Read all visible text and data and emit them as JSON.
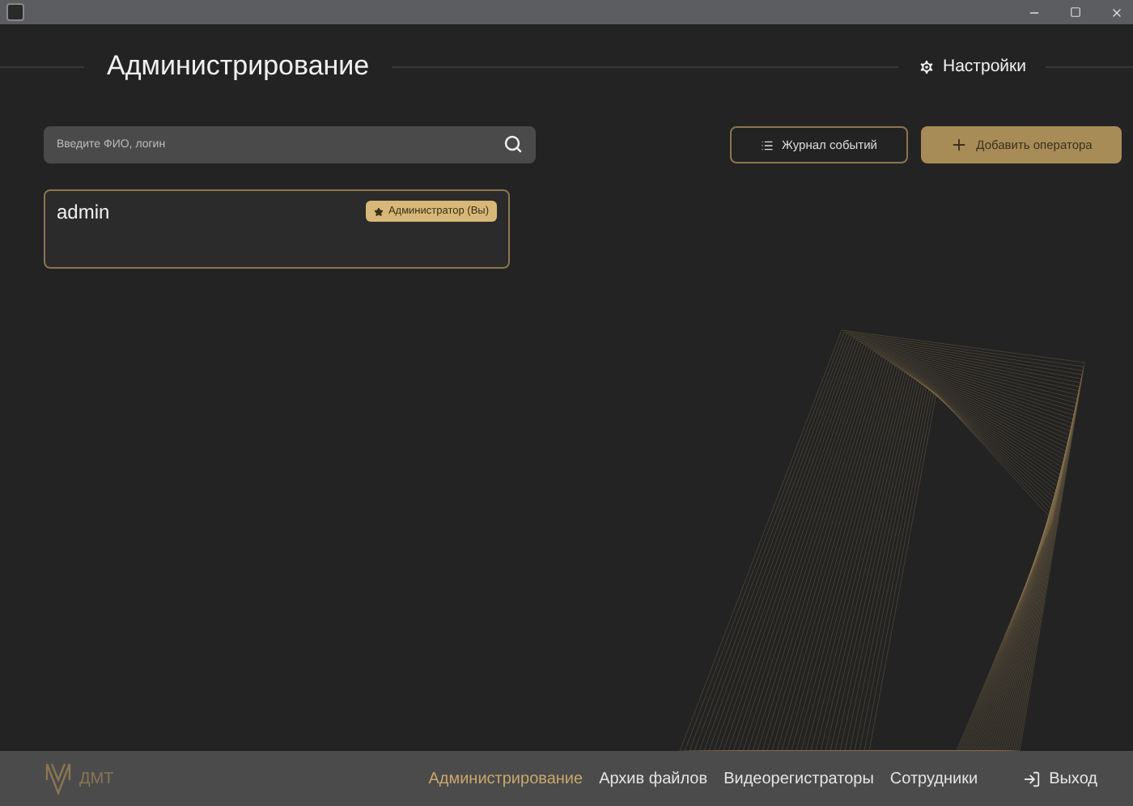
{
  "header": {
    "title": "Администрирование",
    "settings": "Настройки"
  },
  "search": {
    "placeholder": "Введите ФИО, логин"
  },
  "actions": [
    {
      "label": "Журнал событий",
      "kind": "outline"
    },
    {
      "label": "Добавить оператора",
      "kind": "primary"
    }
  ],
  "operators": [
    {
      "login": "admin",
      "role": "Администратор (Вы)"
    }
  ],
  "footer": {
    "logo": "ДМТ",
    "nav": [
      {
        "label": "Администрирование",
        "selected": true
      },
      {
        "label": "Архив файлов",
        "selected": false
      },
      {
        "label": "Видеорегистраторы",
        "selected": false
      },
      {
        "label": "Сотрудники",
        "selected": false
      }
    ],
    "logout": "Выход"
  }
}
